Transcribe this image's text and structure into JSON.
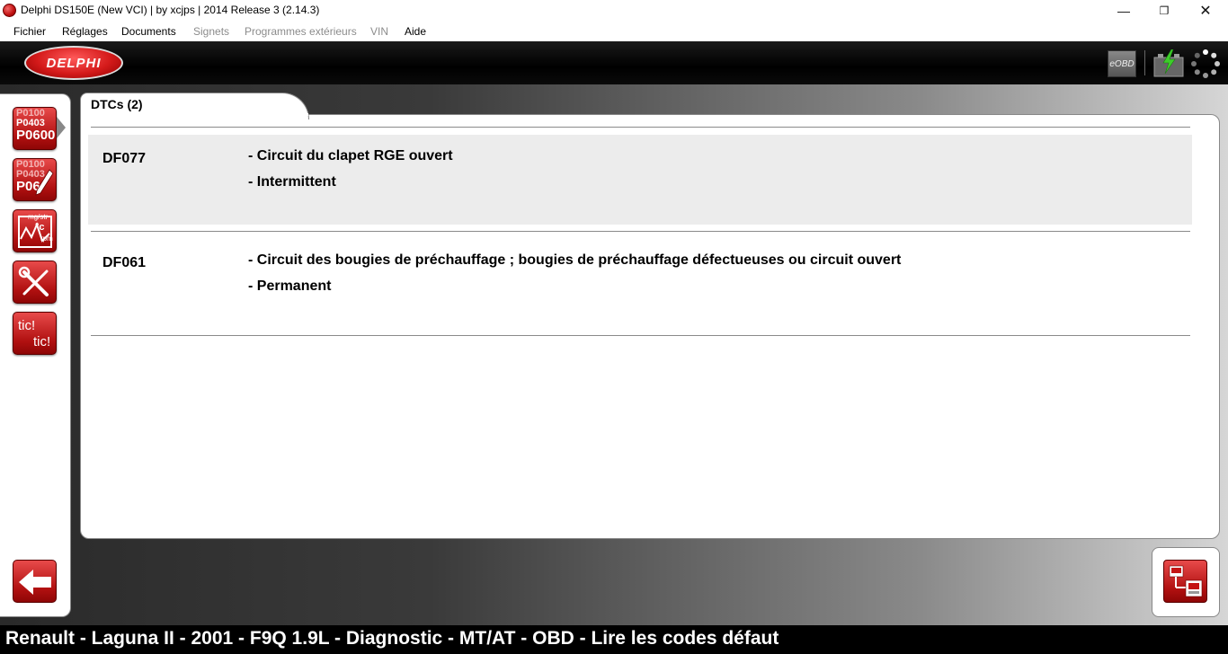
{
  "window": {
    "title": "Delphi DS150E (New VCI) | by xcjps | 2014 Release 3 (2.14.3)",
    "minimize": "—",
    "maximize": "❐",
    "close": "✕"
  },
  "menu": {
    "items": [
      {
        "label": "Fichier",
        "enabled": true
      },
      {
        "label": "Réglages",
        "enabled": true
      },
      {
        "label": "Documents",
        "enabled": true
      },
      {
        "label": "Signets",
        "enabled": false
      },
      {
        "label": "Programmes extérieurs",
        "enabled": false
      },
      {
        "label": "VIN",
        "enabled": false
      },
      {
        "label": "Aide",
        "enabled": true
      }
    ]
  },
  "header": {
    "logo": "DELPHI",
    "eobd_label": "eOBD",
    "icons": [
      "battery-charge-icon",
      "busy-spinner-icon"
    ]
  },
  "toolbar": {
    "read_codes": {
      "lines": [
        "P0100",
        "P0403",
        "P0600"
      ]
    },
    "clear_codes": {
      "lines": [
        "P0100",
        "P0403",
        "P06"
      ]
    },
    "live_data": {
      "lines": [
        "mg/str",
        "°c",
        "rpm"
      ]
    },
    "tic_tic": {
      "lines": [
        "tic!",
        "tic!"
      ]
    }
  },
  "tab": {
    "label": "DTCs (2)"
  },
  "dtcs": [
    {
      "code": "DF077",
      "lines": [
        "- Circuit du clapet RGE ouvert",
        "- Intermittent"
      ]
    },
    {
      "code": "DF061",
      "lines": [
        "- Circuit des bougies de préchauffage ; bougies de préchauffage défectueuses ou circuit ouvert",
        "- Permanent"
      ]
    }
  ],
  "status": {
    "text": "Renault - Laguna II - 2001 - F9Q 1.9L - Diagnostic - MT/AT - OBD - Lire les codes défaut"
  },
  "colors": {
    "accent": "#c41414",
    "header_bg": "#000000",
    "row_shade": "#ececec"
  }
}
